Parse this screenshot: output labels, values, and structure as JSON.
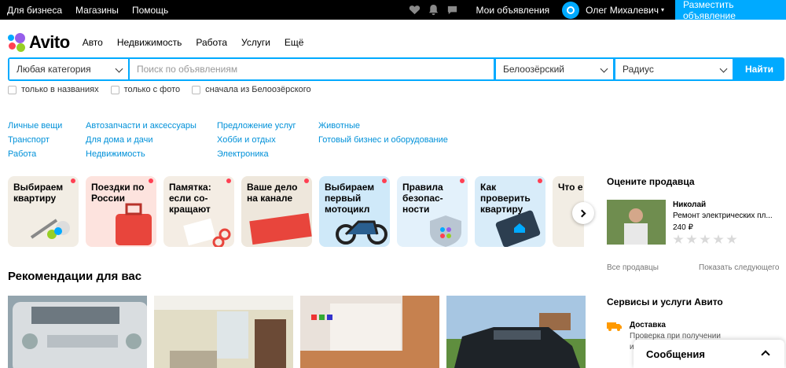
{
  "topbar": {
    "links": [
      "Для бизнеса",
      "Магазины",
      "Помощь"
    ],
    "icons": [
      "heart-icon",
      "bell-icon",
      "chat-icon"
    ],
    "my_ads": "Мои объявления",
    "user_name": "Олег Михалевич",
    "place_ad": "Разместить объявление"
  },
  "brand": {
    "name": "Avito",
    "dot_colors": [
      "#00aaff",
      "#965eeb",
      "#ff4053",
      "#97cf26"
    ]
  },
  "nav": [
    "Авто",
    "Недвижимость",
    "Работа",
    "Услуги",
    "Ещё"
  ],
  "search": {
    "category": "Любая категория",
    "placeholder": "Поиск по объявлениям",
    "location": "Белоозёрский",
    "radius": "Радиус",
    "button": "Найти",
    "accent": "#00aaff"
  },
  "filters": [
    "только в названиях",
    "только с фото",
    "сначала из Белоозёрского"
  ],
  "categories": [
    [
      "Личные вещи",
      "Транспорт",
      "Работа"
    ],
    [
      "Автозапчасти и аксессуары",
      "Для дома и дачи",
      "Недвижимость"
    ],
    [
      "Предложение услуг",
      "Хобби и отдых",
      "Электроника"
    ],
    [
      "Животные",
      "Готовый бизнес и оборудование"
    ]
  ],
  "stories": [
    {
      "title": "Выбираем квартиру",
      "bg": "#f2ede4"
    },
    {
      "title": "Поездки по России",
      "bg": "#fde3de"
    },
    {
      "title": "Памятка: если со- кращают",
      "bg": "#f4ede4"
    },
    {
      "title": "Ваше дело на канале",
      "bg": "#eee7dc"
    },
    {
      "title": "Выбираем первый мотоцикл",
      "bg": "#cfe9f9"
    },
    {
      "title": "Правила безопас- ности",
      "bg": "#e3f1fb"
    },
    {
      "title": "Как проверить квартиру",
      "bg": "#d8ecf9"
    },
    {
      "title": "Что е на Ави",
      "bg": "#f2ede4"
    }
  ],
  "recommendations": {
    "title": "Рекомендации для вас"
  },
  "sidebar": {
    "rate_title": "Оцените продавца",
    "seller_name": "Николай",
    "seller_item": "Ремонт электрических пл...",
    "seller_price": "240 ₽",
    "all_sellers": "Все продавцы",
    "show_next": "Показать следующего",
    "services_title": "Сервисы и услуги Авито",
    "service_name": "Доставка",
    "service_desc": "Проверка при получении",
    "service_desc2": "и"
  },
  "messages": {
    "label": "Сообщения"
  }
}
